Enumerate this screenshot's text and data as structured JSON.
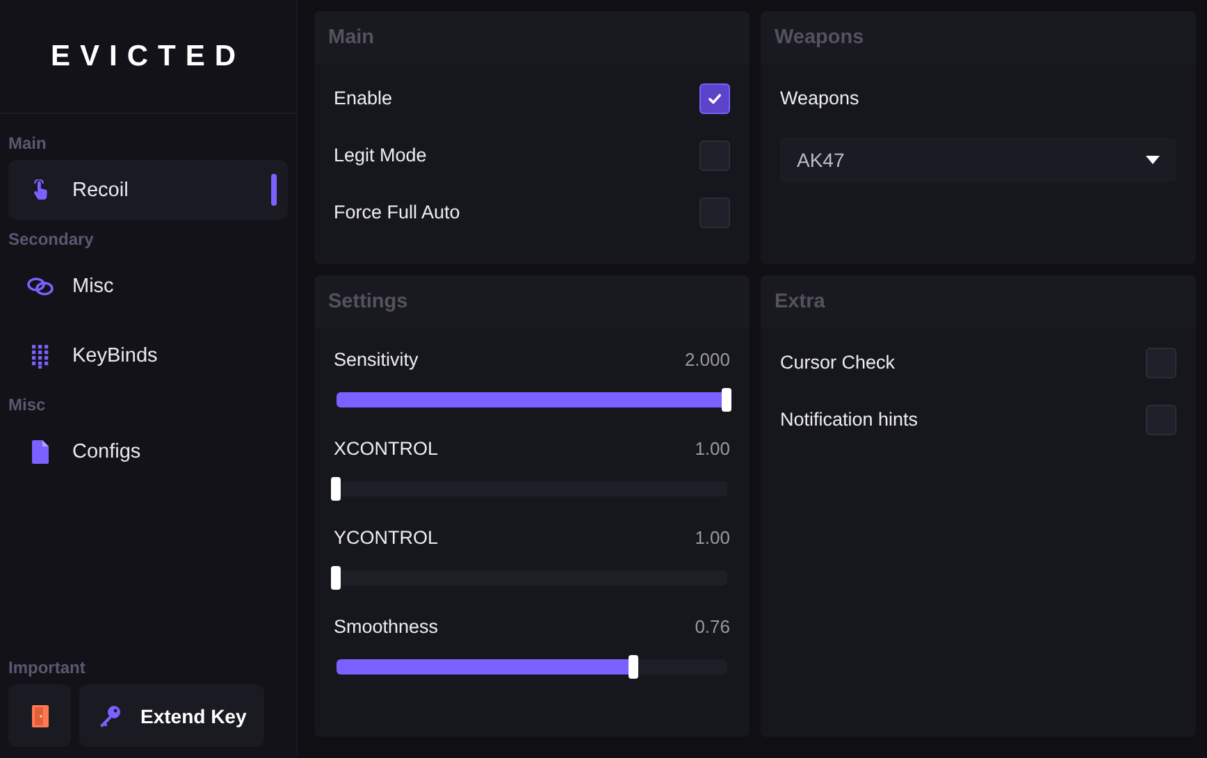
{
  "logo": "EVICTED",
  "sidebar": {
    "sections": [
      {
        "title": "Main",
        "items": [
          {
            "label": "Recoil",
            "selected": true
          }
        ]
      },
      {
        "title": "Secondary",
        "items": [
          {
            "label": "Misc",
            "selected": false
          },
          {
            "label": "KeyBinds",
            "selected": false
          }
        ]
      },
      {
        "title": "Misc",
        "items": [
          {
            "label": "Configs",
            "selected": false
          }
        ]
      }
    ],
    "footer": {
      "title": "Important",
      "extend_button": "Extend Key"
    }
  },
  "main_panel": {
    "title": "Main",
    "options": [
      {
        "label": "Enable",
        "checked": true
      },
      {
        "label": "Legit Mode",
        "checked": false
      },
      {
        "label": "Force Full Auto",
        "checked": false
      }
    ]
  },
  "weapons_panel": {
    "title": "Weapons",
    "label": "Weapons",
    "dropdown": "AK47"
  },
  "settings_panel": {
    "title": "Settings",
    "sliders": [
      {
        "label": "Sensitivity",
        "reading": "2.000",
        "level": 1
      },
      {
        "label": "XCONTROL",
        "reading": "1.00",
        "level": 0
      },
      {
        "label": "YCONTROL",
        "reading": "1.00",
        "level": 0
      },
      {
        "label": "Smoothness",
        "reading": "0.76",
        "level": 0.76
      }
    ]
  },
  "extra_panel": {
    "title": "Extra",
    "options": [
      {
        "label": "Cursor Check",
        "checked": false
      },
      {
        "label": "Notification hints",
        "checked": false
      }
    ]
  }
}
